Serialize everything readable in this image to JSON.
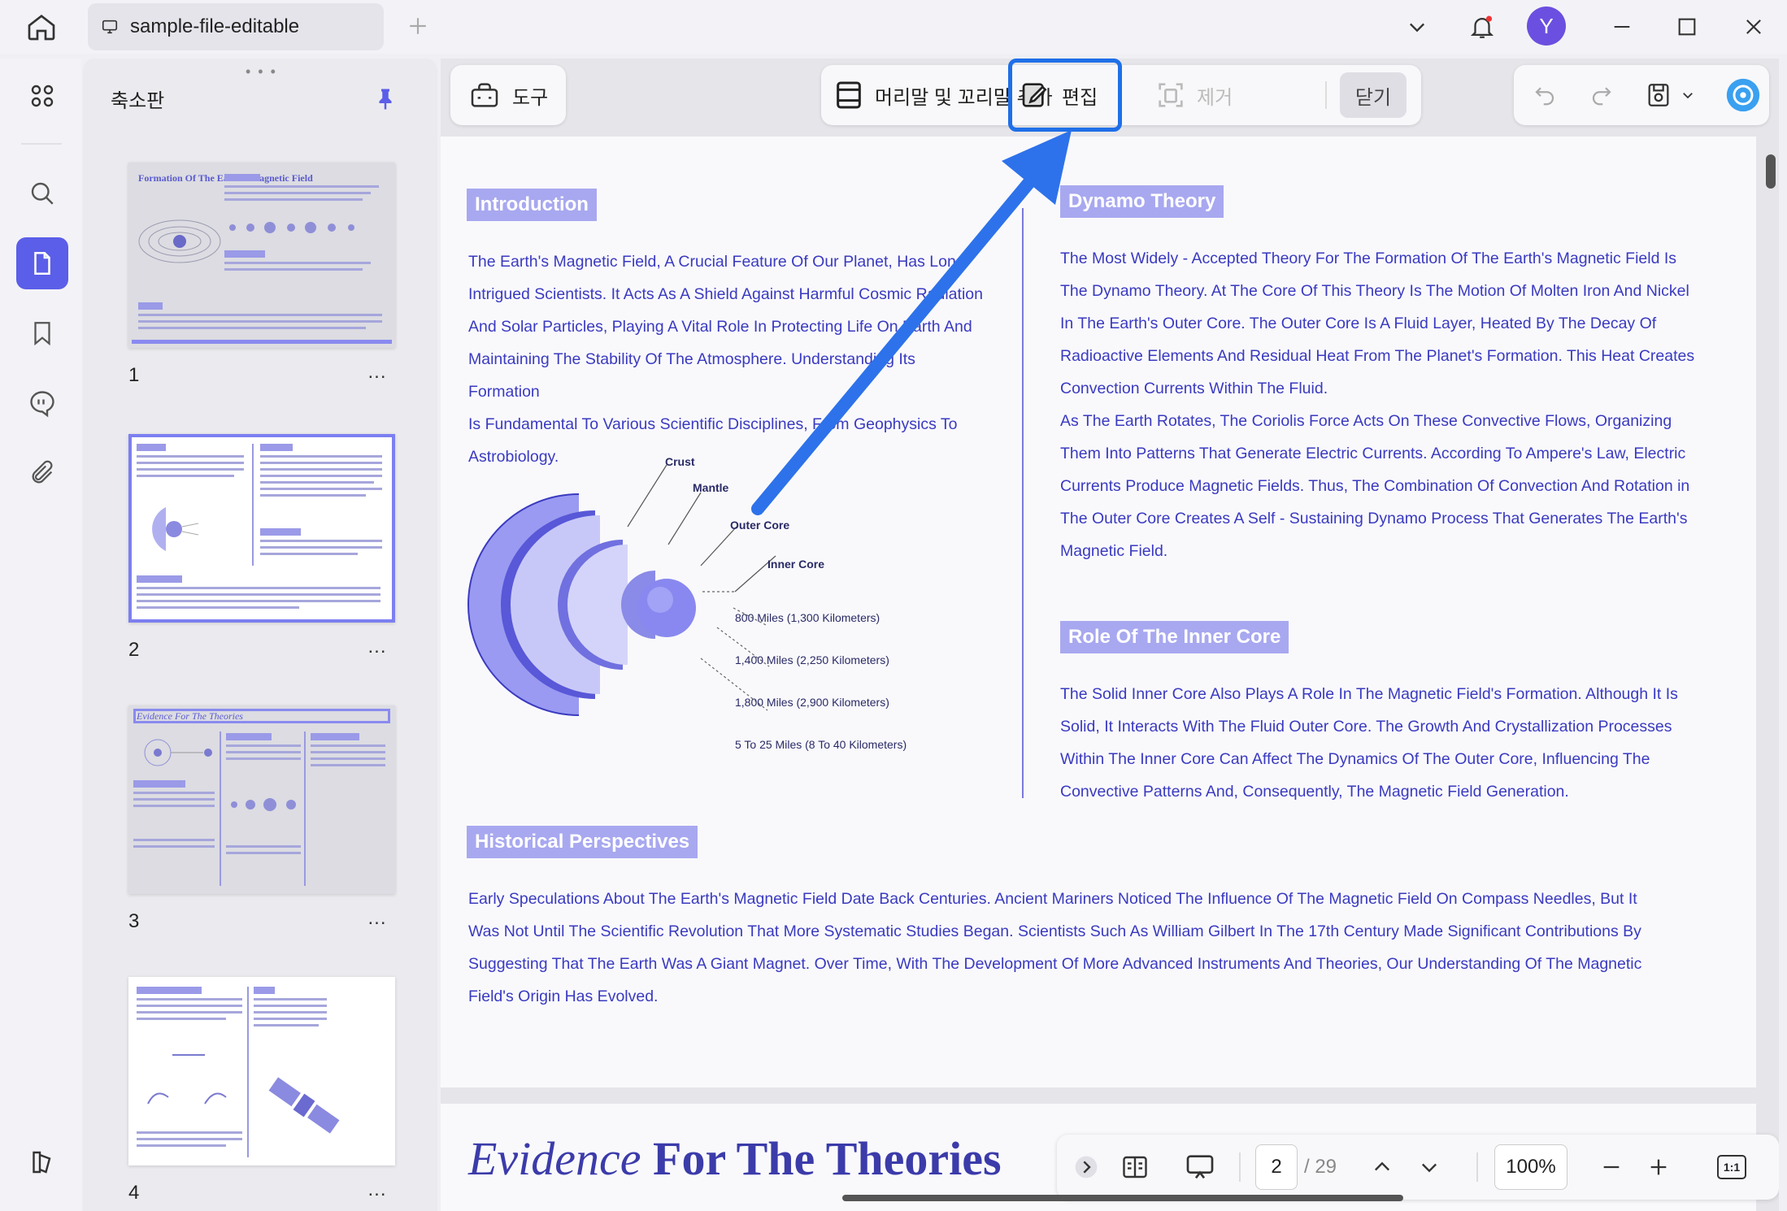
{
  "tab": {
    "title": "sample-file-editable"
  },
  "window": {
    "avatar_letter": "Y"
  },
  "sidebar": {
    "panel_title": "축소판",
    "thumbnails": [
      {
        "number": "1",
        "title": "Formation Of The Earth's Magnetic Field"
      },
      {
        "number": "2"
      },
      {
        "number": "3",
        "title": "Evidence For The Theories"
      },
      {
        "number": "4"
      }
    ],
    "more_glyph": "..."
  },
  "toolbar": {
    "tool_label": "도구",
    "add_header_footer_label": "머리말 및 꼬리말 추가",
    "edit_label": "편집",
    "remove_label": "제거",
    "close_label": "닫기"
  },
  "document": {
    "introduction": {
      "heading": "Introduction",
      "lines": [
        "The Earth's Magnetic Field, A Crucial Feature Of Our Planet, Has Long",
        "Intrigued Scientists. It Acts As A Shield Against Harmful Cosmic Radiation",
        "And Solar Particles, Playing A Vital Role In Protecting Life On Earth And",
        "Maintaining The Stability Of The Atmosphere. Understanding Its Formation",
        "Is Fundamental To Various Scientific Disciplines, From Geophysics To",
        "Astrobiology."
      ]
    },
    "diagram": {
      "layers": [
        "Crust",
        "Mantle",
        "Outer Core",
        "Inner Core"
      ],
      "distances": [
        "800 Miles (1,300 Kilometers)",
        "1,400 Miles (2,250 Kilometers)",
        "1,800 Miles (2,900 Kilometers)",
        "5 To 25 Miles (8 To 40 Kilometers)"
      ]
    },
    "dynamo": {
      "heading": "Dynamo Theory",
      "lines": [
        "The Most Widely - Accepted Theory For The Formation Of The Earth's Magnetic Field Is",
        "The Dynamo Theory. At The Core Of This Theory Is The Motion Of Molten Iron And Nickel",
        "In The Earth's Outer Core. The Outer Core Is A Fluid Layer, Heated By The Decay Of",
        "Radioactive Elements And Residual Heat From The Planet's Formation. This Heat Creates",
        "Convection Currents Within The Fluid.",
        "As The Earth Rotates, The Coriolis Force Acts On These Convective Flows, Organizing",
        "Them Into Patterns That Generate Electric Currents. According To Ampere's Law, Electric",
        "Currents Produce Magnetic Fields. Thus, The Combination Of Convection And Rotation in",
        "The Outer Core Creates A Self - Sustaining Dynamo Process That Generates The Earth's",
        "Magnetic Field."
      ]
    },
    "inner_core": {
      "heading": "Role Of The Inner Core",
      "lines": [
        "The Solid Inner Core Also Plays A Role In The Magnetic Field's Formation. Although It Is",
        "Solid, It Interacts With The Fluid Outer Core. The Growth And Crystallization Processes",
        "Within The Inner Core Can Affect The Dynamics Of The Outer Core, Influencing The",
        "Convective Patterns And, Consequently, The Magnetic Field Generation."
      ]
    },
    "historical": {
      "heading": "Historical Perspectives",
      "lines": [
        "Early Speculations About The Earth's Magnetic Field Date Back Centuries. Ancient Mariners Noticed The Influence Of The Magnetic Field On Compass Needles, But It",
        "Was Not Until The Scientific Revolution That More Systematic Studies Began. Scientists Such As William Gilbert In The 17th Century Made Significant Contributions By",
        "Suggesting That The Earth Was A Giant Magnet. Over Time, With The Development Of More Advanced Instruments And Theories, Our Understanding Of The Magnetic",
        "Field's Origin Has Evolved."
      ]
    },
    "next_page_title": {
      "italic": "Evidence ",
      "bold": "For The Theories"
    }
  },
  "navigation": {
    "current_page": "2",
    "total_pages": "/ 29",
    "zoom": "100%",
    "actual_size_label": "1:1"
  },
  "colors": {
    "accent": "#5b5ee8",
    "highlight_border": "#1f6fe8",
    "doc_text": "#3a3ac0",
    "section_heading_bg": "#a8a8f0"
  }
}
